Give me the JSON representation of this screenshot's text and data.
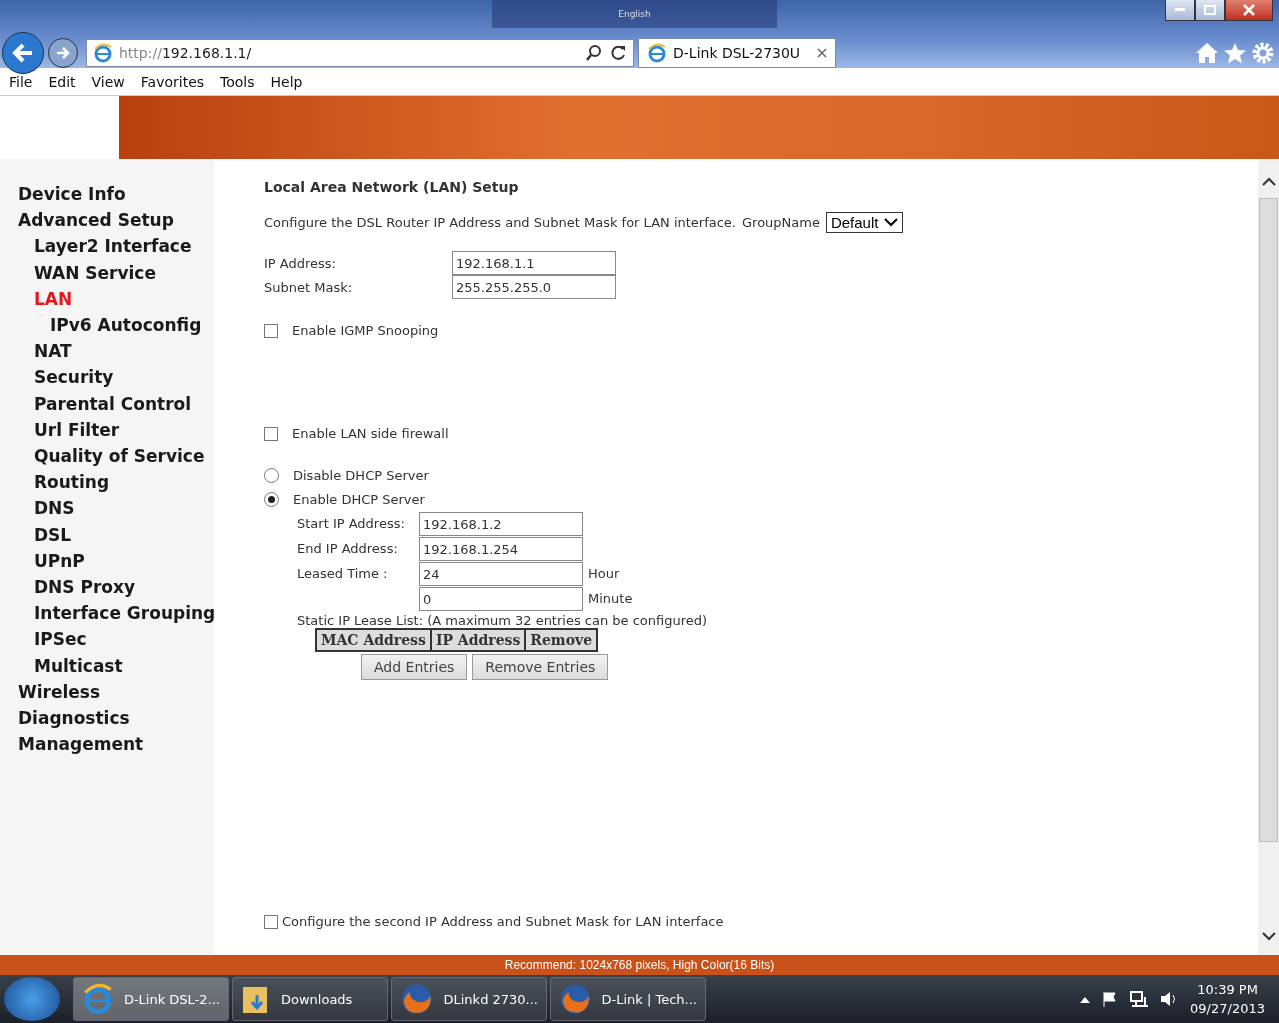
{
  "browser": {
    "floating_toolbar_label": "English",
    "address": {
      "scheme": "http://",
      "host": "192.168.1.1/"
    },
    "tab": {
      "title": "D-Link DSL-2730U",
      "selected": true
    },
    "menu": [
      "File",
      "Edit",
      "View",
      "Favorites",
      "Tools",
      "Help"
    ]
  },
  "sidebar": {
    "items": [
      {
        "label": "Device Info",
        "selected": false
      },
      {
        "label": "Advanced Setup",
        "selected": false,
        "children": [
          {
            "label": "Layer2 Interface",
            "selected": false
          },
          {
            "label": "WAN Service",
            "selected": false
          },
          {
            "label": "LAN",
            "selected": true,
            "children": [
              {
                "label": "IPv6 Autoconfig",
                "selected": false
              }
            ]
          },
          {
            "label": "NAT",
            "selected": false
          },
          {
            "label": "Security",
            "selected": false
          },
          {
            "label": "Parental Control",
            "selected": false
          },
          {
            "label": "Url Filter",
            "selected": false
          },
          {
            "label": "Quality of Service",
            "selected": false
          },
          {
            "label": "Routing",
            "selected": false
          },
          {
            "label": "DNS",
            "selected": false
          },
          {
            "label": "DSL",
            "selected": false
          },
          {
            "label": "UPnP",
            "selected": false
          },
          {
            "label": "DNS Proxy",
            "selected": false
          },
          {
            "label": "Interface Grouping",
            "selected": false
          },
          {
            "label": "IPSec",
            "selected": false
          },
          {
            "label": "Multicast",
            "selected": false
          }
        ]
      },
      {
        "label": "Wireless",
        "selected": false
      },
      {
        "label": "Diagnostics",
        "selected": false
      },
      {
        "label": "Management",
        "selected": false
      }
    ]
  },
  "main": {
    "title": "Local Area Network (LAN) Setup",
    "description": "Configure the DSL Router IP Address and Subnet Mask for LAN interface.",
    "group": {
      "label": "GroupName",
      "value": "Default"
    },
    "ip_fields": [
      {
        "label": "IP Address:",
        "value": "192.168.1.1"
      },
      {
        "label": "Subnet Mask:",
        "value": "255.255.255.0"
      }
    ],
    "igmp_snooping": {
      "label": "Enable IGMP Snooping",
      "checked": false
    },
    "lan_firewall": {
      "label": "Enable LAN side firewall",
      "checked": false
    },
    "dhcp_options": [
      {
        "label": "Disable DHCP Server",
        "selected": false
      },
      {
        "label": "Enable DHCP Server",
        "selected": true
      }
    ],
    "dhcp_fields": [
      {
        "label": "Start IP Address:",
        "value": "192.168.1.2"
      },
      {
        "label": "End IP Address:",
        "value": "192.168.1.254"
      },
      {
        "label": "Leased Time :",
        "value": "24",
        "unit": "Hour"
      },
      {
        "value": "0",
        "unit": "Minute"
      }
    ],
    "lease_note": "Static IP Lease List: (A maximum 32 entries can be configured)",
    "lease_table": {
      "columns": [
        "MAC Address",
        "IP Address",
        "Remove"
      ]
    },
    "buttons": [
      "Add Entries",
      "Remove Entries"
    ],
    "second_ip": {
      "label": "Configure the second IP Address and Subnet Mask for LAN interface",
      "checked": false
    }
  },
  "status_bar": "Recommend: 1024x768 pixels, High Color(16 Bits)",
  "taskbar": {
    "items": [
      {
        "label": "D-Link DSL-2...",
        "kind": "ie",
        "active": true
      },
      {
        "label": "Downloads",
        "kind": "folder",
        "active": false
      },
      {
        "label": "DLinkd 2730...",
        "kind": "firefox",
        "active": false
      },
      {
        "label": "D-Link | Tech...",
        "kind": "firefox",
        "active": false
      }
    ],
    "time": "10:39 PM",
    "date": "09/27/2013"
  }
}
